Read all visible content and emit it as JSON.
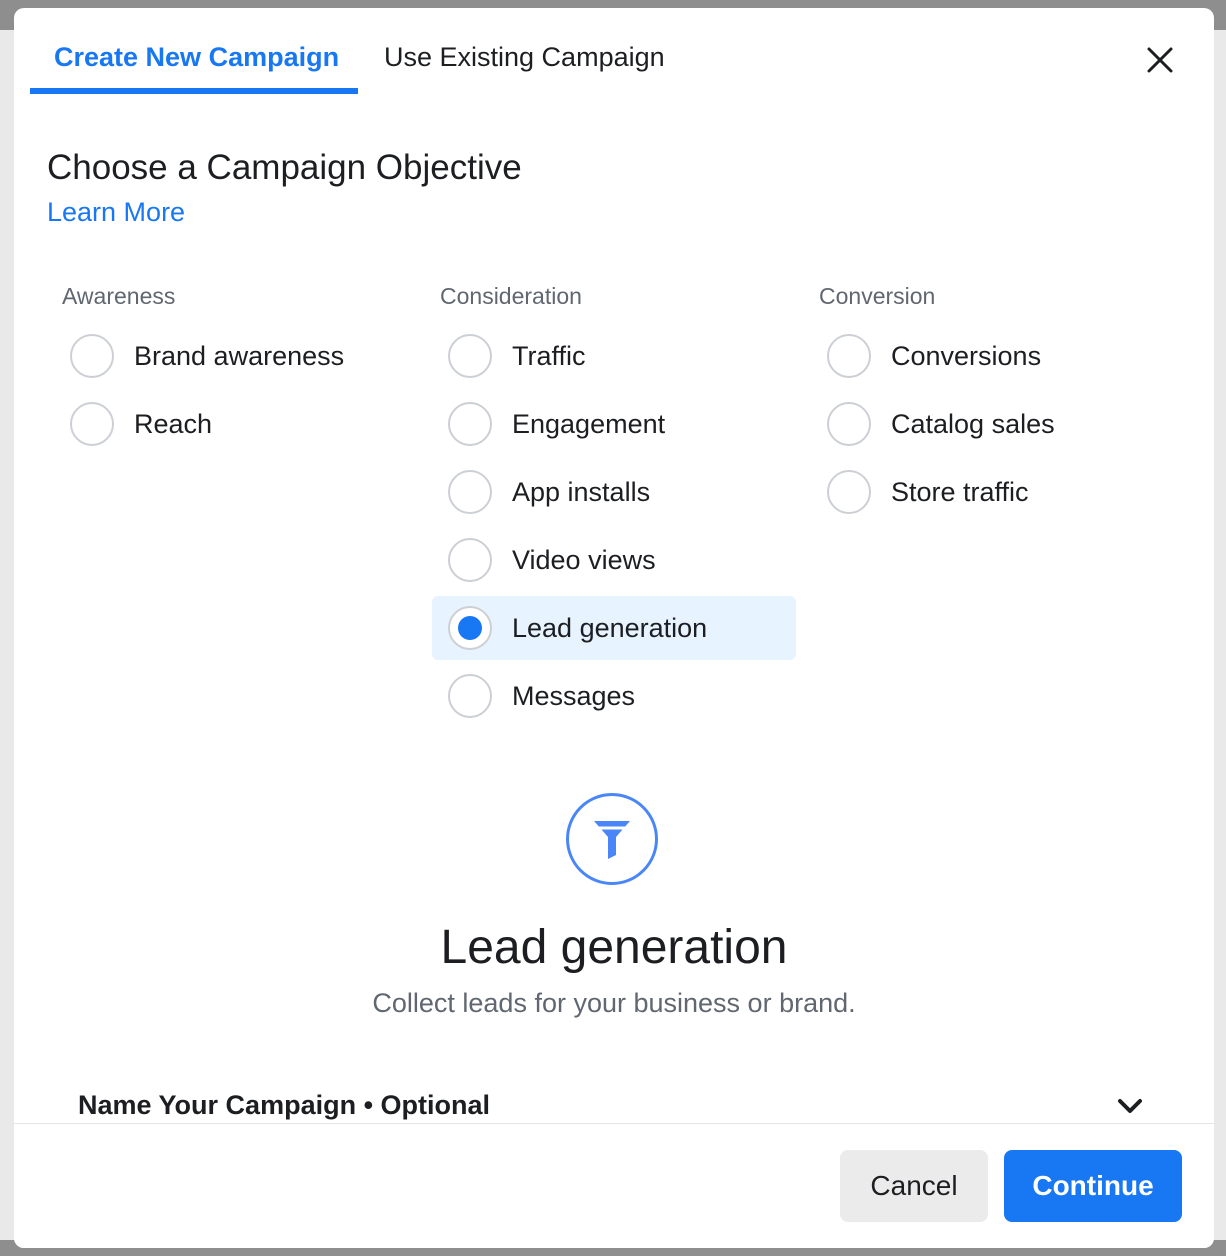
{
  "tabs": {
    "create_label": "Create New Campaign",
    "existing_label": "Use Existing Campaign"
  },
  "heading": "Choose a Campaign Objective",
  "learn_more": "Learn More",
  "columns": {
    "awareness": {
      "title": "Awareness",
      "options": [
        "Brand awareness",
        "Reach"
      ]
    },
    "consideration": {
      "title": "Consideration",
      "options": [
        "Traffic",
        "Engagement",
        "App installs",
        "Video views",
        "Lead generation",
        "Messages"
      ]
    },
    "conversion": {
      "title": "Conversion",
      "options": [
        "Conversions",
        "Catalog sales",
        "Store traffic"
      ]
    }
  },
  "selected_option": "Lead generation",
  "detail": {
    "icon": "funnel-icon",
    "title": "Lead generation",
    "description": "Collect leads for your business or brand."
  },
  "name_campaign": "Name Your Campaign • Optional",
  "footer": {
    "cancel_label": "Cancel",
    "continue_label": "Continue"
  },
  "colors": {
    "accent": "#1877f2",
    "selected_bg": "#e7f3ff"
  }
}
